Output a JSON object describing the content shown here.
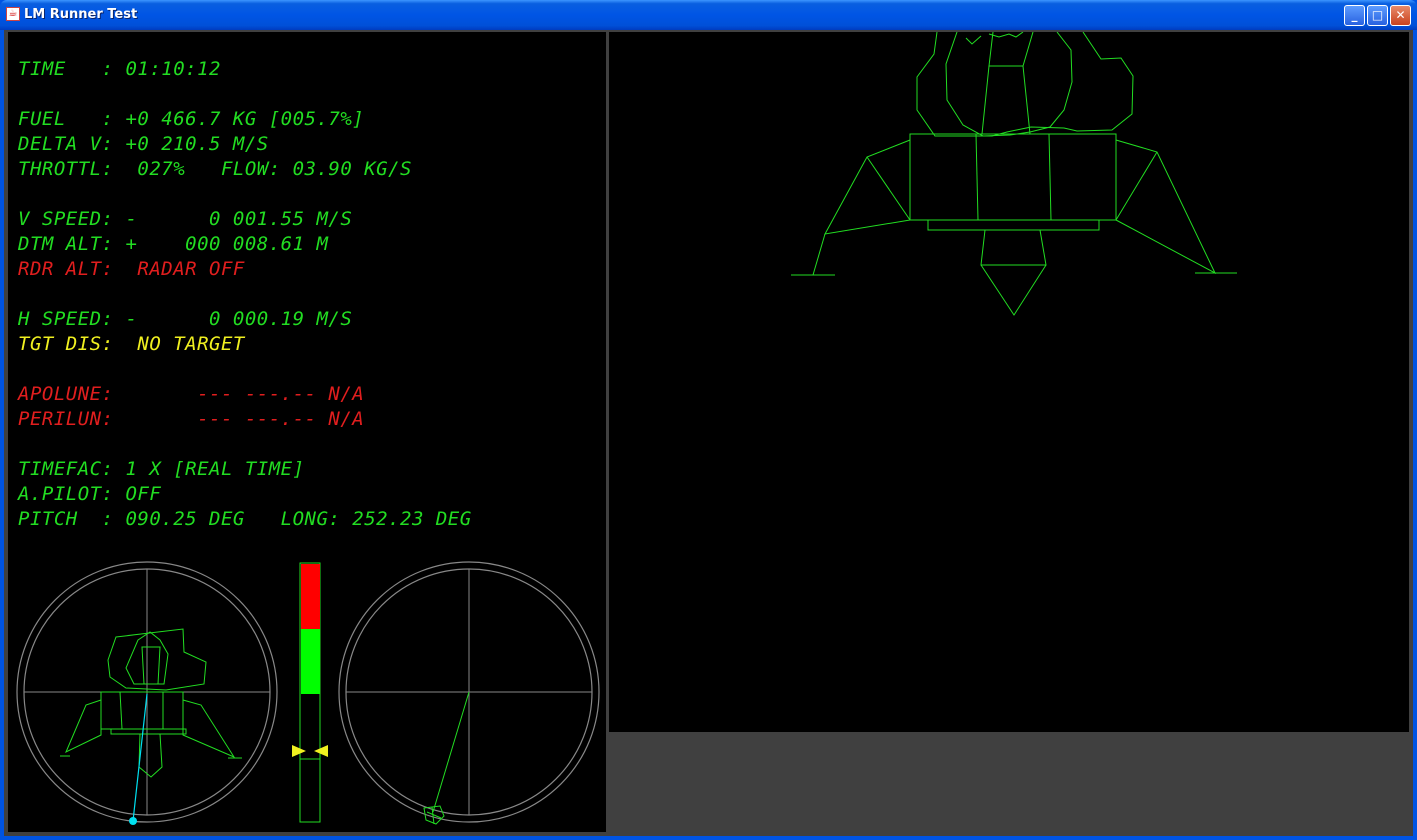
{
  "window": {
    "title": "LM Runner Test",
    "minimize_label": "_",
    "maximize_label": "□",
    "close_label": "✕",
    "app_icon": "java-cup-icon"
  },
  "readouts": {
    "time": "TIME   : 01:10:12",
    "fuel": "FUEL   : +0 466.7 KG [005.7%]",
    "delta_v": "DELTA V: +0 210.5 M/S",
    "throttle": "THROTTL:  027%   FLOW: 03.90 KG/S",
    "v_speed": "V SPEED: -      0 001.55 M/S",
    "dtm_alt": "DTM ALT: +    000 008.61 M",
    "rdr_alt": "RDR ALT:  RADAR OFF",
    "h_speed": "H SPEED: -      0 000.19 M/S",
    "tgt_dis": "TGT DIS:  NO TARGET",
    "apolune": "APOLUNE:       --- ---.-- N/A",
    "perilun": "PERILUN:       --- ---.-- N/A",
    "timefac": "TIMEFAC: 1 X [REAL TIME]",
    "autopilot": "A.PILOT: OFF",
    "pitch_long": "PITCH  : 090.25 DEG   LONG: 252.23 DEG"
  },
  "instruments": {
    "throttle_gauge": {
      "red_fraction": 0.25,
      "green_fraction": 0.25,
      "marker_fraction": 0.73
    },
    "colors": {
      "readout_green": "#22dd22",
      "alert_red": "#e01e1e",
      "target_yellow": "#f0f020",
      "vector_cyan": "#00e0f0"
    }
  }
}
